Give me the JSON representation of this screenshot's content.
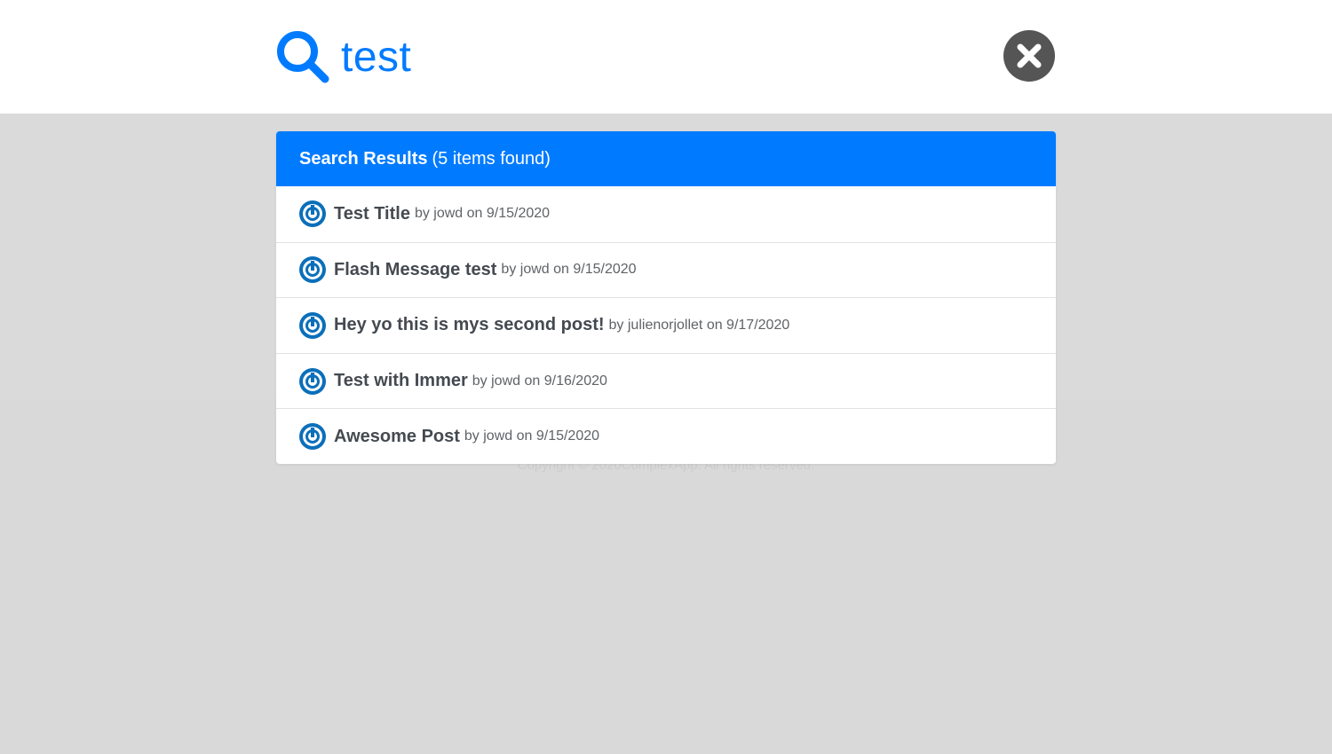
{
  "search": {
    "value": "test",
    "icon": "search-icon",
    "close_icon": "close-icon"
  },
  "results": {
    "header_strong": "Search Results",
    "header_count": "(5 items found)",
    "items": [
      {
        "title": "Test Title",
        "meta": "by jowd on 9/15/2020"
      },
      {
        "title": "Flash Message test",
        "meta": "by jowd on 9/15/2020"
      },
      {
        "title": "Hey yo this is mys second post!",
        "meta": "by julienorjollet on 9/17/2020"
      },
      {
        "title": "Test with Immer",
        "meta": "by jowd on 9/16/2020"
      },
      {
        "title": "Awesome Post",
        "meta": "by jowd on 9/15/2020"
      }
    ]
  },
  "footer": {
    "copyright": "Copyright © 2020ComplexApp. All rights reserved."
  },
  "colors": {
    "accent": "#007bff",
    "close": "#555555",
    "overlay": "#dadada"
  }
}
